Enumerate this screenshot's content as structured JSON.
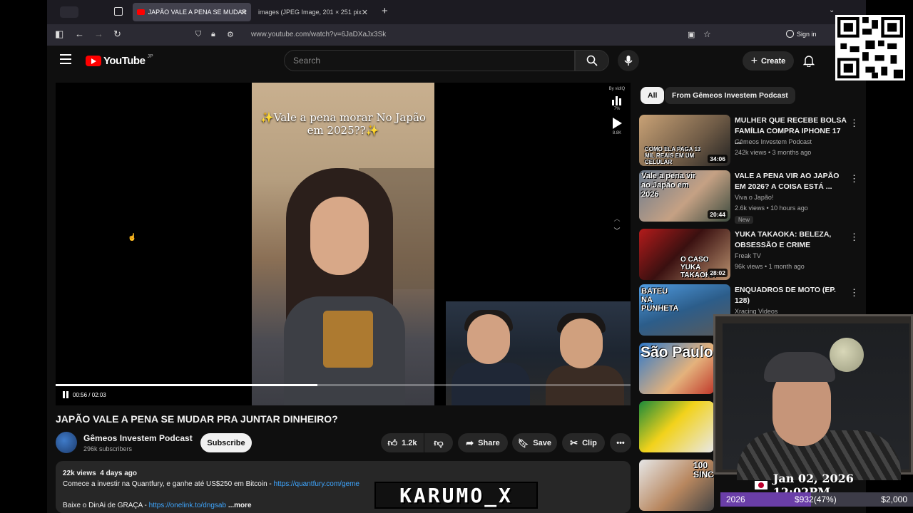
{
  "browser": {
    "tabs": [
      {
        "label": "JAPÃO VALE A PENA SE MUDAR",
        "active": true
      },
      {
        "label": "images (JPEG Image, 201 × 251 pix",
        "active": false
      }
    ],
    "new_tab": "+",
    "url": "www.youtube.com/watch?v=6JaDXaJx3Sk",
    "signin_label": "Sign in"
  },
  "youtube": {
    "logo_text": "YouTube",
    "region": "JP",
    "search_placeholder": "Search",
    "create_label": "Create"
  },
  "player": {
    "video_caption": "✨Vale a pena morar No Japão em 2025??✨",
    "side_brand": "By vidIQ",
    "side_percent": "7%",
    "side_views": "8.8K",
    "time_current": "00:56",
    "time_total": "02:03",
    "progress": 0.455
  },
  "video": {
    "title": "JAPÃO VALE A PENA SE MUDAR PRA JUNTAR DINHEIRO?",
    "channel": "Gêmeos Investem Podcast",
    "subscribers": "296k subscribers",
    "subscribe_label": "Subscribe",
    "likes": "1.2k",
    "share_label": "Share",
    "save_label": "Save",
    "clip_label": "Clip",
    "views": "22k views",
    "age": "4 days ago",
    "desc_line1_text": "Comece a investir na Quantfury, e ganhe até US$250 em Bitcoin - ",
    "desc_line1_link": "https://quantfury.com/geme",
    "desc_line2_text": "Baixe o DinAi de GRAÇA - ",
    "desc_line2_link": "https://onelink.to/dngsab",
    "more_label": "...more"
  },
  "chips": [
    "All",
    "From Gêmeos Investem Podcast"
  ],
  "recommendations": [
    {
      "title": "MULHER QUE RECEBE BOLSA FAMÍLIA COMPRA IPHONE 17 ...",
      "channel": "Gêmeos Investem Podcast",
      "meta": "242k views • 3 months ago",
      "duration": "34:06",
      "thumb_text": "COMO ELA PAGA 13 MIL REAIS EM UM CELULAR"
    },
    {
      "title": "VALE A PENA VIR AO JAPÃO EM 2026? A COISA ESTÁ ...",
      "channel": "Viva o Japão!",
      "meta": "2.6k views • 10 hours ago",
      "duration": "20:44",
      "badge": "New",
      "thumb_text": "Vale a pena vir ao Japão em 2026"
    },
    {
      "title": "YUKA TAKAOKA: BELEZA, OBSESSÃO E CRIME",
      "channel": "Freak TV",
      "meta": "96k views • 1 month ago",
      "duration": "28:02",
      "thumb_text": "O CASO YUKA TAKAOKA"
    },
    {
      "title": "ENQUADROS DE MOTO (EP. 128)",
      "channel": "Xracing Videos",
      "thumb_text": "BATEU NA PUNHETA"
    }
  ],
  "extra_thumbs": [
    "São Paulo",
    "",
    "100 SINC"
  ],
  "overlay": {
    "date": "Jan 02, 2026 12:02PM",
    "goal_year": "2026",
    "goal_current": "$932(47%)",
    "goal_total": "$2,000",
    "goal_fraction": 0.47,
    "streamer_name": "KARUMO_X"
  }
}
